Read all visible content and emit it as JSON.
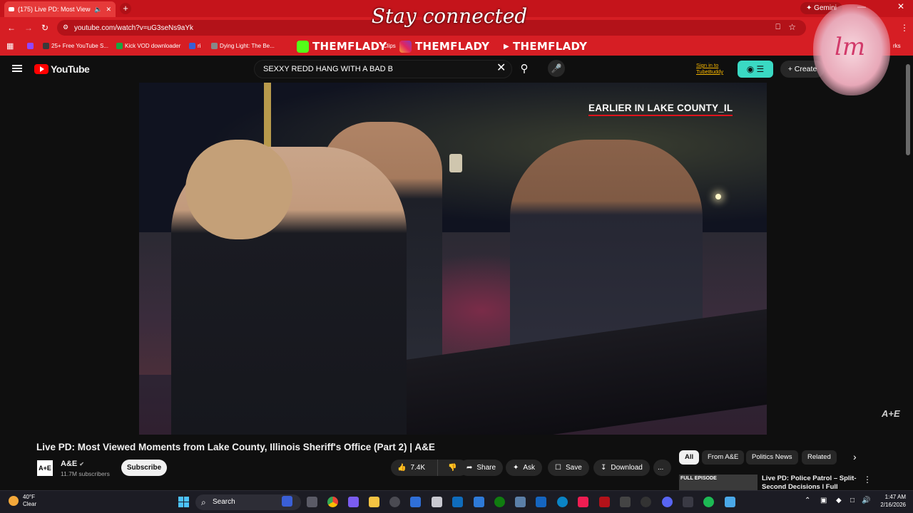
{
  "browser": {
    "tab_title": "(175) Live PD: Most Viewed",
    "new_tab": "+",
    "url": "youtube.com/watch?v=uG3seNs9aYk",
    "gemini_label": "Gemini",
    "bookmarks": [
      {
        "label": "25+ Free YouTube S...",
        "color": "#3a3a3a"
      },
      {
        "label": "Kick VOD downloader",
        "color": "#19a640"
      },
      {
        "label": "ri",
        "color": "#3a5fd6"
      },
      {
        "label": "Dying Light: The Be...",
        "color": "#888888"
      },
      {
        "label": "Clips",
        "color": "#e02c6c"
      },
      {
        "label": "rks",
        "color": "#888888"
      }
    ],
    "overlay_brands": [
      "THEMFLADY",
      "THEMFLADY",
      "THEMFLADY"
    ],
    "overlay_banner": "Stay connected",
    "sticker_text": "lm"
  },
  "youtube": {
    "logo": "YouTube",
    "search_value": "SEXXY REDD HANG WITH A BAD B",
    "tubebuddy_signin": "Sign in to TubeBuddy",
    "create_label": "Create",
    "video": {
      "caption": "EARLIER IN LAKE COUNTY_IL",
      "watermark": "A+E"
    },
    "title": "Live PD: Most Viewed Moments from Lake County, Illinois Sheriff's Office (Part 2) | A&E",
    "channel": {
      "avatar": "A+E",
      "name": "A&E",
      "subscribers": "11.7M subscribers",
      "subscribe_label": "Subscribe"
    },
    "actions": {
      "likes": "7.4K",
      "share": "Share",
      "ask": "Ask",
      "save": "Save",
      "download": "Download",
      "more": "..."
    },
    "chips": [
      "All",
      "From A&E",
      "Politics News",
      "Related"
    ],
    "recommendation": {
      "thumb_label": "FULL EPISODE",
      "title": "Live PD: Police Patrol – Split-Second Decisions | Full Episode"
    }
  },
  "taskbar": {
    "temperature": "40°F",
    "condition": "Clear",
    "search_label": "Search",
    "time": "1:47 AM",
    "date": "2/16/2026"
  }
}
